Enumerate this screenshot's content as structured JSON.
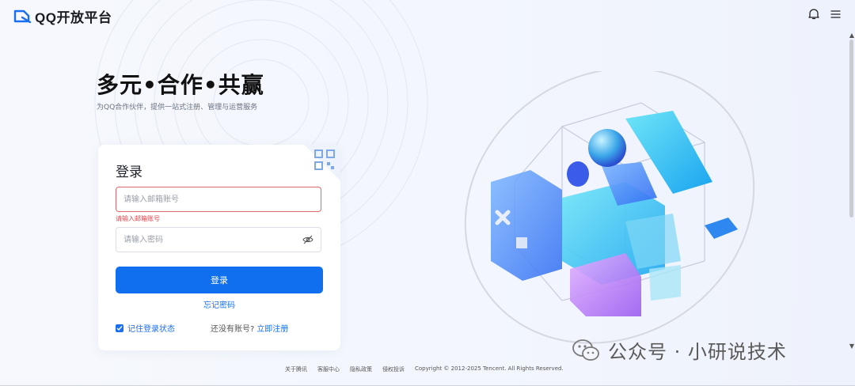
{
  "header": {
    "logo_text": "QQ开放平台",
    "bell_icon": "bell-icon",
    "menu_icon": "menu-icon"
  },
  "hero": {
    "title": "多元•合作•共赢",
    "subtitle": "为QQ合作伙伴，提供一站式注册、管理与运营服务"
  },
  "login": {
    "title": "登录",
    "email_placeholder": "请输入邮箱账号",
    "email_value": "",
    "email_error": "请输入邮箱账号",
    "password_placeholder": "请输入密码",
    "password_value": "",
    "submit_label": "登录",
    "forgot_label": "忘记密码",
    "remember_label": "记住登录状态",
    "remember_checked": true,
    "no_account_text": "还没有账号?",
    "register_label": "立即注册",
    "qr_icon": "qrcode-icon",
    "eye_icon": "eye-off-icon"
  },
  "footer": {
    "links": [
      "关于腾讯",
      "客服中心",
      "隐私政策",
      "侵权投诉"
    ],
    "copyright": "Copyright © 2012-2025 Tencent. All Rights Reserved."
  },
  "watermark": {
    "text": "公众号 · 小研说技术",
    "icon": "wechat-icon"
  },
  "colors": {
    "primary": "#0f6fee",
    "error": "#e0474c",
    "background": "#f4f6fd"
  }
}
